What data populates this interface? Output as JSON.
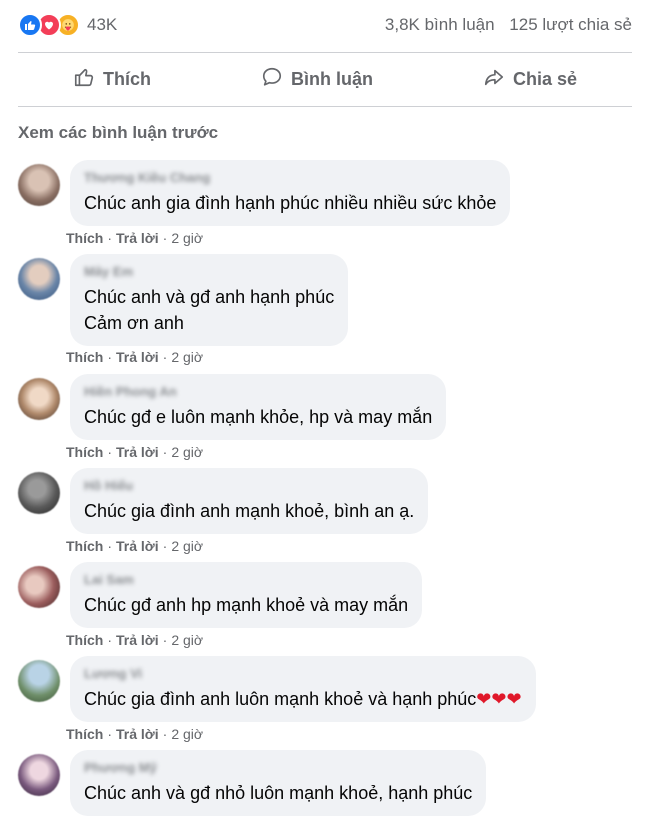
{
  "post_stats": {
    "reaction_count": "43K",
    "comment_count": "3,8K bình luận",
    "share_count": "125 lượt chia sẻ",
    "reaction_icons": [
      "like-icon",
      "love-icon",
      "care-icon"
    ]
  },
  "actions": {
    "like": "Thích",
    "comment": "Bình luận",
    "share": "Chia sẻ"
  },
  "previous_comments_link": "Xem các bình luận trước",
  "comment_meta": {
    "like": "Thích",
    "reply": "Trả lời",
    "separator": "·"
  },
  "comments": [
    {
      "author": "Thương Kiều Chang",
      "lines": [
        "Chúc anh gia đình hạnh phúc nhiều nhiều sức khỏe"
      ],
      "time": "2 giờ",
      "avatar_color": "#8a6f63"
    },
    {
      "author": "Mây Em",
      "lines": [
        "Chúc anh và gđ anh hạnh phúc",
        "Cảm ơn anh"
      ],
      "time": "2 giờ",
      "avatar_color": "#6b86a8"
    },
    {
      "author": "Hiền Phong An",
      "lines": [
        "Chúc gđ e luôn mạnh khỏe, hp và may mắn"
      ],
      "time": "2 giờ",
      "avatar_color": "#b08a6c"
    },
    {
      "author": "Hồ Hiếu",
      "lines": [
        "Chúc gia đình anh mạnh khoẻ, bình an ạ."
      ],
      "time": "2 giờ",
      "avatar_color": "#5a5a5a"
    },
    {
      "author": "Lai Sam",
      "lines": [
        "Chúc gđ anh hp mạnh khoẻ và may mắn"
      ],
      "time": "2 giờ",
      "avatar_color": "#9c5e5e"
    },
    {
      "author": "Lương Vi",
      "lines": [
        "Chúc gia đình anh luôn mạnh khoẻ và hạnh phúc"
      ],
      "hearts": "❤❤❤",
      "time": "2 giờ",
      "avatar_color": "#6f8f6a"
    },
    {
      "author": "Phương Mỹ",
      "lines": [
        "Chúc anh và gđ nhỏ luôn mạnh khoẻ, hạnh phúc"
      ],
      "time": "",
      "avatar_color": "#7a5a7e"
    }
  ],
  "colors": {
    "bubble_bg": "#f0f2f5",
    "secondary_text": "#65676b",
    "like_blue": "#1877f2",
    "love_red": "#f33e58",
    "heart_red": "#e0182a"
  }
}
